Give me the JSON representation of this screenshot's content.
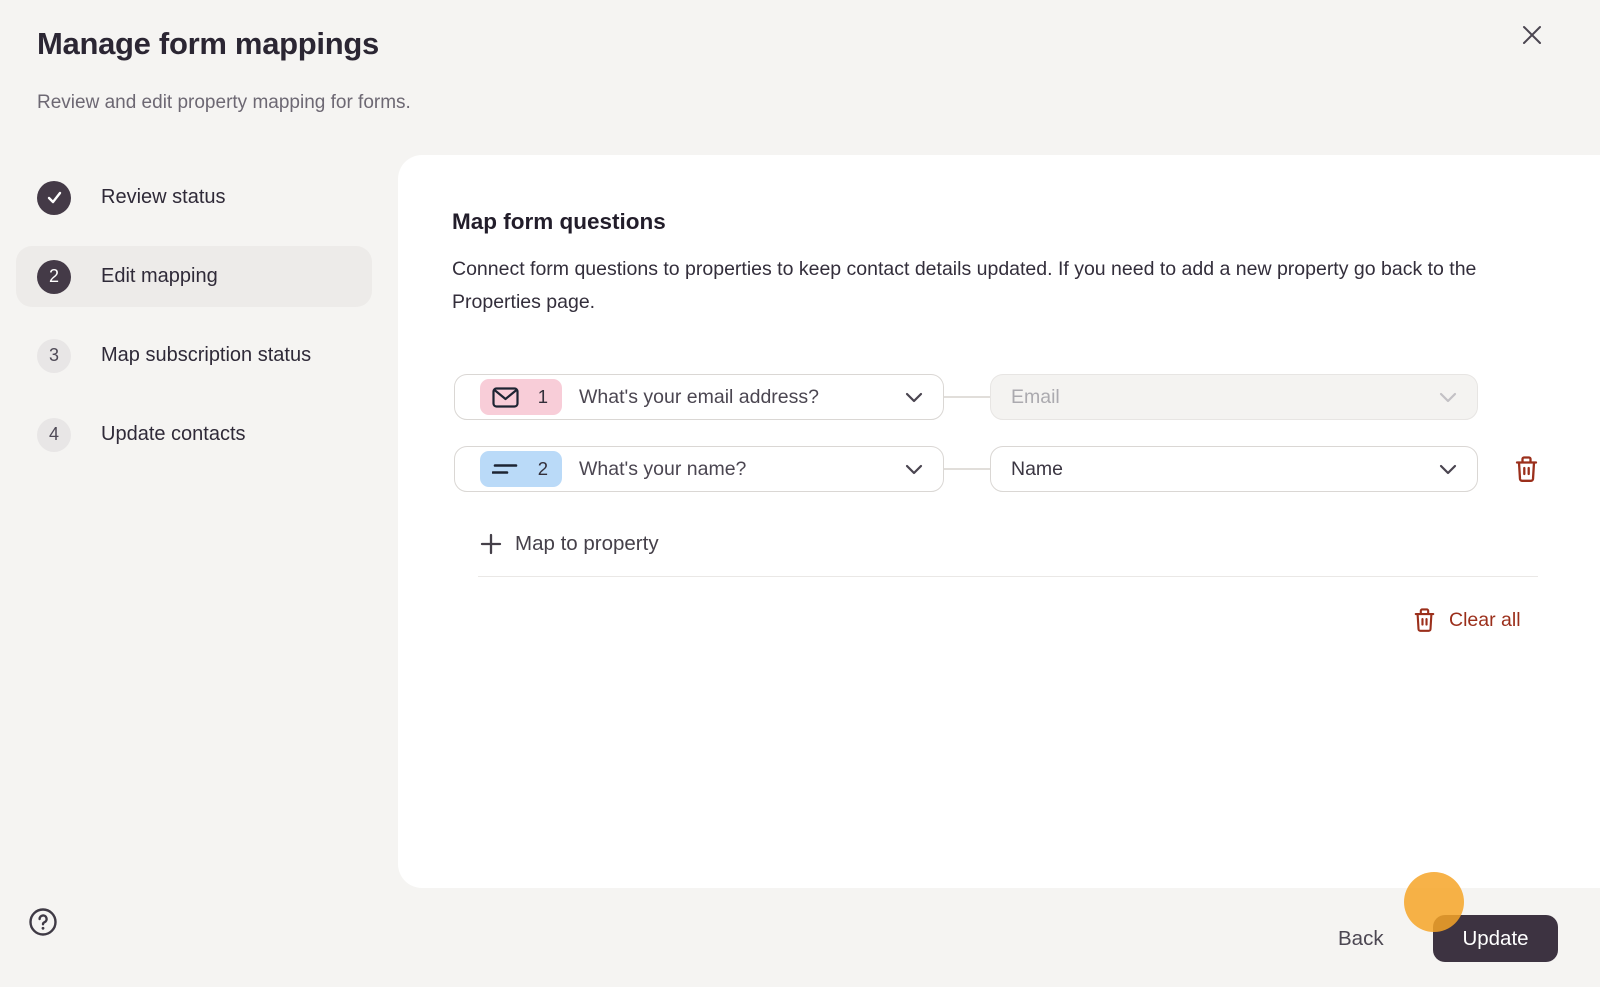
{
  "modal": {
    "title": "Manage form mappings",
    "subtitle": "Review and edit property mapping for forms."
  },
  "steps": [
    {
      "label": "Review status",
      "state": "done"
    },
    {
      "number": "2",
      "label": "Edit mapping",
      "state": "active"
    },
    {
      "number": "3",
      "label": "Map subscription status",
      "state": "upcoming"
    },
    {
      "number": "4",
      "label": "Update contacts",
      "state": "upcoming"
    }
  ],
  "content": {
    "heading": "Map form questions",
    "description": "Connect form questions to properties to keep contact details updated. If you need to add a new property go back to the Properties page.",
    "mappings": [
      {
        "order": "1",
        "icon": "email-icon",
        "question": "What's your email address?",
        "property": "Email",
        "property_disabled": true,
        "removable": false
      },
      {
        "order": "2",
        "icon": "short-text-icon",
        "question": "What's your name?",
        "property": "Name",
        "property_disabled": false,
        "removable": true
      }
    ],
    "add_mapping_label": "Map to property",
    "clear_all_label": "Clear all"
  },
  "footer": {
    "back_label": "Back",
    "update_label": "Update"
  },
  "colors": {
    "accent_dark": "#3d3341",
    "danger_red": "#9b2f1b",
    "badge_pink": "#f8cdd8",
    "badge_blue": "#badaf8",
    "click_indicator_orange": "#f6a428",
    "panel_white": "#ffffff",
    "page_background": "#f5f4f2"
  }
}
